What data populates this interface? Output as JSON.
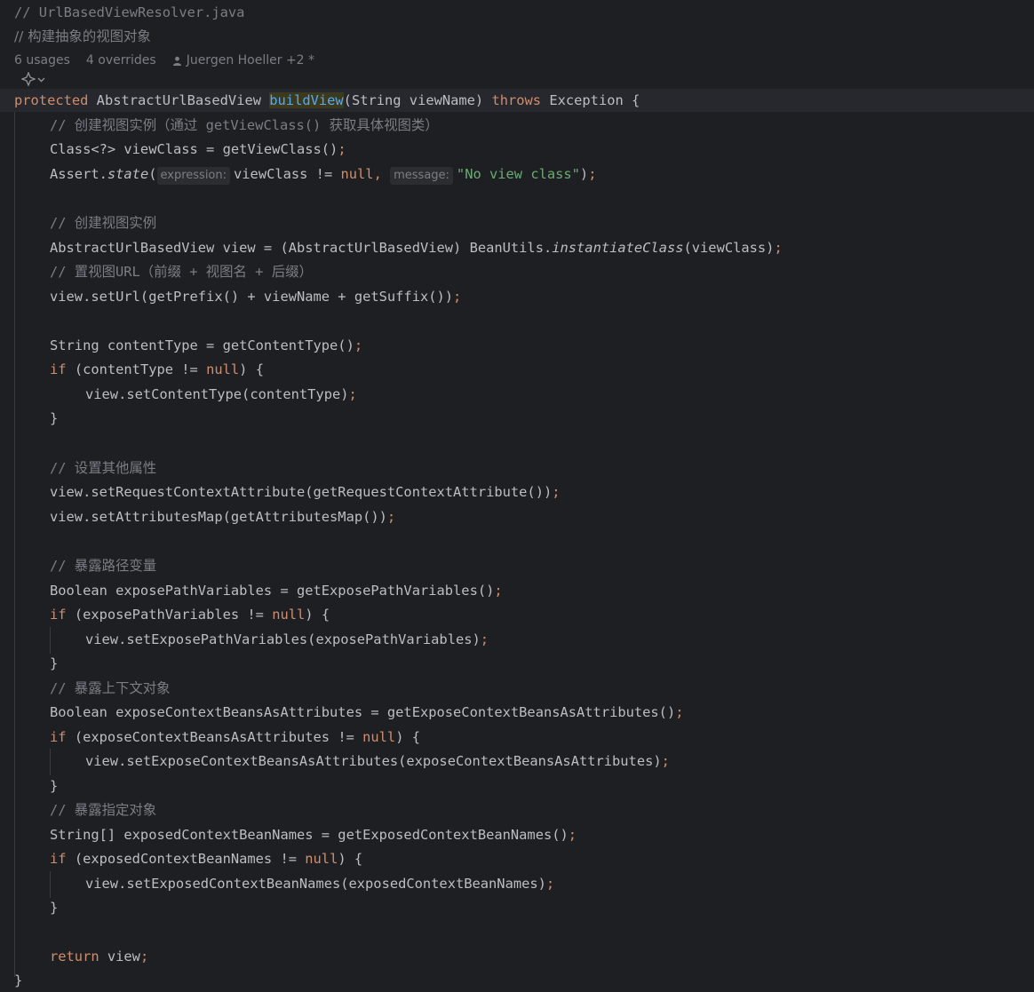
{
  "editor": {
    "header_comments": [
      "// UrlBasedViewResolver.java",
      "// 构建抽象的视图对象"
    ],
    "meta": {
      "usages": "6 usages",
      "overrides": "4 overrides",
      "author": "Juergen Hoeller +2 *"
    },
    "icons": {
      "author": "person-icon",
      "gutter": "ai-assistant-icon",
      "dropdown": "chevron-down-icon"
    },
    "hints": {
      "expression": "expression:",
      "message": "message:"
    },
    "code": {
      "sig_protected": "protected",
      "sig_ret": " AbstractUrlBasedView ",
      "sig_name": "buildView",
      "sig_params": "(String viewName) ",
      "sig_throws": "throws",
      "sig_exc": " Exception {",
      "c1": "// 创建视图实例（通过 getViewClass() 获取具体视图类）",
      "l2": "Class<?> viewClass = getViewClass()",
      "l3a": "Assert.",
      "l3b": "state",
      "l3c": "(",
      "l3d": "viewClass != ",
      "l3e": "null",
      "l3f": ", ",
      "l3g": "\"No view class\"",
      "l3h": ")",
      "c2": "// 创建视图实例",
      "l5a": "AbstractUrlBasedView view = (AbstractUrlBasedView) BeanUtils.",
      "l5b": "instantiateClass",
      "l5c": "(viewClass)",
      "c3": "// 置视图URL（前缀 + 视图名 + 后缀）",
      "l7": "view.setUrl(getPrefix() + viewName + getSuffix())",
      "l8": "String contentType = getContentType()",
      "l9a": "if",
      "l9b": " (contentType != ",
      "l9c": "null",
      "l9d": ") {",
      "l10": "view.setContentType(contentType)",
      "close": "}",
      "c4": "// 设置其他属性",
      "l12": "view.setRequestContextAttribute(getRequestContextAttribute())",
      "l13": "view.setAttributesMap(getAttributesMap())",
      "c5": "// 暴露路径变量",
      "l15": "Boolean exposePathVariables = getExposePathVariables()",
      "l16a": "if",
      "l16b": " (exposePathVariables != ",
      "l16c": "null",
      "l16d": ") {",
      "l17": "view.setExposePathVariables(exposePathVariables)",
      "c6": "// 暴露上下文对象",
      "l19": "Boolean exposeContextBeansAsAttributes = getExposeContextBeansAsAttributes()",
      "l20a": "if",
      "l20b": " (exposeContextBeansAsAttributes != ",
      "l20c": "null",
      "l20d": ") {",
      "l21": "view.setExposeContextBeansAsAttributes(exposeContextBeansAsAttributes)",
      "c7": "// 暴露指定对象",
      "l23": "String[] exposedContextBeanNames = getExposedContextBeanNames()",
      "l24a": "if",
      "l24b": " (exposedContextBeanNames != ",
      "l24c": "null",
      "l24d": ") {",
      "l25": "view.setExposedContextBeanNames(exposedContextBeanNames)",
      "l27a": "return",
      "l27b": " view",
      "semi": ";"
    }
  }
}
